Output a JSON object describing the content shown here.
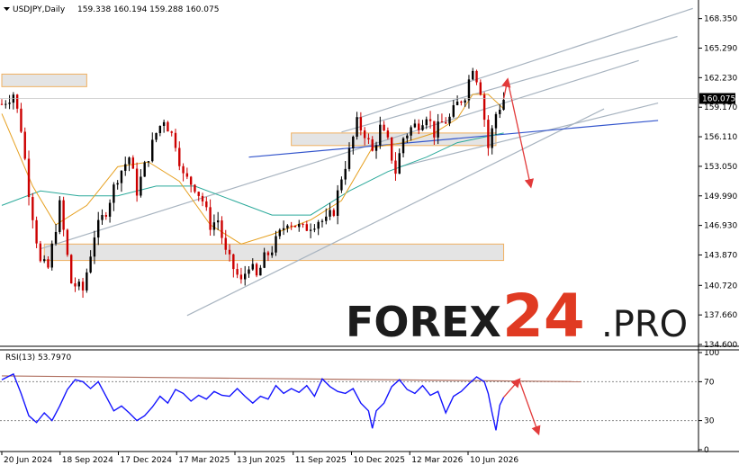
{
  "header": {
    "symbol_label": "USDJPY,Daily",
    "ohlc": "159.338 160.194 159.288 160.075"
  },
  "watermark": {
    "brand": "FOREX",
    "number": "24",
    "suffix": ".PRO"
  },
  "colors": {
    "candle_up": "#000000",
    "candle_down": "#cc0000",
    "ma_fast": "#e6a020",
    "ma_slow": "#2aa99a",
    "channel": "#a8b4c0",
    "blue_trend": "#3355cc",
    "zone_fill": "#e4e4e4",
    "zone_border": "#f0b060",
    "forecast_arrow": "#e23a3a",
    "rsi_line": "#1414ff",
    "rsi_trend": "#b07060",
    "price_tag_bg": "#000000",
    "axis_line": "#000000"
  },
  "chart_data": [
    {
      "type": "candlestick",
      "title": "USDJPY,Daily",
      "current_price": "160.075",
      "ylim": [
        134.6,
        169.9
      ],
      "yticks": [
        "168.350",
        "165.290",
        "162.230",
        "159.170",
        "156.110",
        "153.050",
        "149.990",
        "146.930",
        "143.870",
        "140.720",
        "137.660",
        "134.600"
      ],
      "x_labels": [
        "20 Jun 2024",
        "18 Sep 2024",
        "17 Dec 2024",
        "17 Mar 2025",
        "13 Jun 2025",
        "11 Sep 2025",
        "10 Dec 2025",
        "12 Mar 2026",
        "10 Jun 2026"
      ],
      "price_path": [
        [
          0,
          159.5
        ],
        [
          3,
          160.6
        ],
        [
          5,
          157.0
        ],
        [
          7,
          150.5
        ],
        [
          10,
          143.0
        ],
        [
          12,
          142.5
        ],
        [
          15,
          149.0
        ],
        [
          18,
          141.0
        ],
        [
          21,
          140.2
        ],
        [
          24,
          146.0
        ],
        [
          27,
          148.5
        ],
        [
          30,
          152.0
        ],
        [
          33,
          154.0
        ],
        [
          35,
          150.5
        ],
        [
          37,
          153.0
        ],
        [
          40,
          156.5
        ],
        [
          42,
          158.0
        ],
        [
          45,
          155.5
        ],
        [
          47,
          152.0
        ],
        [
          50,
          151.0
        ],
        [
          52,
          149.5
        ],
        [
          54,
          147.0
        ],
        [
          56,
          147.5
        ],
        [
          58,
          144.0
        ],
        [
          60,
          142.5
        ],
        [
          62,
          141.0
        ],
        [
          64,
          143.0
        ],
        [
          66,
          141.5
        ],
        [
          68,
          143.5
        ],
        [
          70,
          144.5
        ],
        [
          72,
          146.0
        ],
        [
          74,
          147.5
        ],
        [
          76,
          147.0
        ],
        [
          78,
          146.5
        ],
        [
          80,
          147.0
        ],
        [
          82,
          147.5
        ],
        [
          84,
          147.3
        ],
        [
          86,
          148.5
        ],
        [
          88,
          152.0
        ],
        [
          90,
          154.5
        ],
        [
          92,
          157.5
        ],
        [
          94,
          156.5
        ],
        [
          96,
          154.5
        ],
        [
          98,
          157.0
        ],
        [
          100,
          155.5
        ],
        [
          102,
          152.5
        ],
        [
          104,
          156.0
        ],
        [
          106,
          157.0
        ],
        [
          108,
          157.5
        ],
        [
          110,
          158.5
        ],
        [
          112,
          156.5
        ],
        [
          114,
          157.5
        ],
        [
          116,
          158.0
        ],
        [
          118,
          159.5
        ],
        [
          120,
          160.5
        ],
        [
          122,
          163.5
        ],
        [
          124,
          161.0
        ],
        [
          125,
          158.0
        ],
        [
          126,
          155.0
        ],
        [
          128,
          158.5
        ],
        [
          130,
          160.0
        ]
      ],
      "candle_count": 130,
      "moving_average_fast": [
        [
          0,
          158.5
        ],
        [
          8,
          151.0
        ],
        [
          14,
          147.0
        ],
        [
          22,
          149.0
        ],
        [
          30,
          153.0
        ],
        [
          38,
          153.5
        ],
        [
          46,
          151.5
        ],
        [
          54,
          147.0
        ],
        [
          62,
          145.0
        ],
        [
          70,
          146.0
        ],
        [
          80,
          147.5
        ],
        [
          88,
          149.5
        ],
        [
          96,
          155.0
        ],
        [
          104,
          155.5
        ],
        [
          112,
          156.5
        ],
        [
          118,
          158.0
        ],
        [
          122,
          160.5
        ],
        [
          126,
          160.5
        ],
        [
          130,
          159.0
        ]
      ],
      "moving_average_slow": [
        [
          0,
          149.0
        ],
        [
          10,
          150.5
        ],
        [
          20,
          150.0
        ],
        [
          30,
          150.0
        ],
        [
          40,
          151.0
        ],
        [
          50,
          151.0
        ],
        [
          60,
          149.5
        ],
        [
          70,
          148.0
        ],
        [
          80,
          148.0
        ],
        [
          90,
          150.5
        ],
        [
          100,
          152.5
        ],
        [
          110,
          154.0
        ],
        [
          118,
          155.5
        ],
        [
          124,
          156.0
        ],
        [
          130,
          156.5
        ]
      ],
      "channel_lines": [
        [
          [
            10,
            144.5
          ],
          [
            165,
            164.0
          ]
        ],
        [
          [
            48,
            137.6
          ],
          [
            156,
            159.0
          ]
        ],
        [
          [
            88,
            156.6
          ],
          [
            175,
            166.5
          ]
        ],
        [
          [
            92,
            158.0
          ],
          [
            179,
            169.4
          ]
        ],
        [
          [
            103,
            153.0
          ],
          [
            170,
            159.6
          ]
        ]
      ],
      "blue_trendline": [
        [
          64,
          154.0
        ],
        [
          170,
          157.8
        ]
      ],
      "zones": [
        {
          "x_from": 75,
          "x_to": 128,
          "y_low": 155.2,
          "y_high": 156.5
        },
        {
          "x_from": 11,
          "x_to": 130,
          "y_low": 143.3,
          "y_high": 145.0
        },
        {
          "x_from": 0,
          "x_to": 22,
          "y_low": 161.3,
          "y_high": 162.6
        }
      ],
      "forecast_path": [
        [
          130,
          160.0
        ],
        [
          131,
          162.0
        ],
        [
          137,
          151.0
        ]
      ]
    },
    {
      "type": "line",
      "title": "RSI(13) 53.7970",
      "ylim": [
        0,
        100
      ],
      "yticks": [
        "100",
        "70",
        "30",
        "0"
      ],
      "levels": [
        30,
        70
      ],
      "values": [
        [
          0,
          72
        ],
        [
          3,
          78
        ],
        [
          5,
          58
        ],
        [
          7,
          35
        ],
        [
          9,
          28
        ],
        [
          11,
          38
        ],
        [
          13,
          30
        ],
        [
          15,
          45
        ],
        [
          17,
          62
        ],
        [
          19,
          72
        ],
        [
          21,
          70
        ],
        [
          23,
          63
        ],
        [
          25,
          70
        ],
        [
          27,
          55
        ],
        [
          29,
          40
        ],
        [
          31,
          45
        ],
        [
          33,
          38
        ],
        [
          35,
          30
        ],
        [
          37,
          35
        ],
        [
          39,
          44
        ],
        [
          41,
          55
        ],
        [
          43,
          48
        ],
        [
          45,
          62
        ],
        [
          47,
          58
        ],
        [
          49,
          50
        ],
        [
          51,
          56
        ],
        [
          53,
          52
        ],
        [
          55,
          60
        ],
        [
          57,
          56
        ],
        [
          59,
          55
        ],
        [
          61,
          63
        ],
        [
          63,
          55
        ],
        [
          65,
          48
        ],
        [
          67,
          55
        ],
        [
          69,
          52
        ],
        [
          71,
          66
        ],
        [
          73,
          58
        ],
        [
          75,
          63
        ],
        [
          77,
          59
        ],
        [
          79,
          66
        ],
        [
          81,
          55
        ],
        [
          83,
          73
        ],
        [
          85,
          65
        ],
        [
          87,
          60
        ],
        [
          89,
          58
        ],
        [
          91,
          63
        ],
        [
          93,
          48
        ],
        [
          95,
          40
        ],
        [
          96,
          22
        ],
        [
          97,
          40
        ],
        [
          99,
          48
        ],
        [
          101,
          65
        ],
        [
          103,
          72
        ],
        [
          105,
          62
        ],
        [
          107,
          58
        ],
        [
          109,
          66
        ],
        [
          111,
          56
        ],
        [
          113,
          60
        ],
        [
          115,
          38
        ],
        [
          117,
          55
        ],
        [
          119,
          60
        ],
        [
          121,
          68
        ],
        [
          123,
          75
        ],
        [
          125,
          70
        ],
        [
          126,
          58
        ],
        [
          127,
          38
        ],
        [
          128,
          20
        ],
        [
          129,
          46
        ],
        [
          130,
          54
        ]
      ],
      "trendline": [
        [
          0,
          76
        ],
        [
          150,
          70
        ]
      ],
      "forecast_path": [
        [
          130,
          54
        ],
        [
          134,
          72
        ],
        [
          139,
          17
        ]
      ]
    }
  ]
}
